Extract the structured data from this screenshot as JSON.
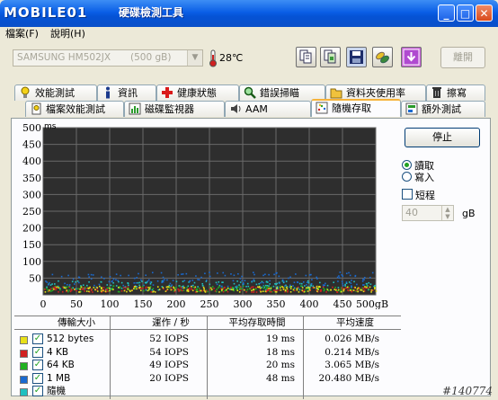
{
  "window": {
    "logo_text": "MOBILE01",
    "title": "硬碟檢測工具",
    "minimize": "_",
    "maximize": "□",
    "close": "✕"
  },
  "menu": [
    {
      "label": "檔案(F)"
    },
    {
      "label": "說明(H)"
    }
  ],
  "toolbar": {
    "drive_select": "SAMSUNG HM502JX",
    "drive_size": "(500 gB)",
    "temperature": "28℃",
    "disconnect_label": "離開"
  },
  "tabs_row1": [
    {
      "label": "效能測試",
      "icon": "bulb-icon"
    },
    {
      "label": "資訊",
      "icon": "info-icon"
    },
    {
      "label": "健康狀態",
      "icon": "health-cross-icon"
    },
    {
      "label": "錯誤掃瞄",
      "icon": "magnifier-icon"
    },
    {
      "label": "資料夾使用率",
      "icon": "folder-icon"
    },
    {
      "label": "擦寫",
      "icon": "trash-icon"
    }
  ],
  "tabs_row2": [
    {
      "label": "檔案效能測試",
      "icon": "file-benchmark-icon"
    },
    {
      "label": "磁碟監視器",
      "icon": "monitor-chart-icon"
    },
    {
      "label": "AAM",
      "icon": "speaker-icon"
    },
    {
      "label": "隨機存取",
      "icon": "random-access-icon",
      "active": true
    },
    {
      "label": "額外測試",
      "icon": "extra-test-icon"
    }
  ],
  "controls": {
    "stop_label": "停止",
    "read_label": "讀取",
    "write_label": "寫入",
    "short_label": "短程",
    "short_value": "40",
    "short_unit": "gB"
  },
  "chart_data": {
    "type": "scatter",
    "y_unit": "ms",
    "x_unit": "gB",
    "xlim": [
      0,
      500
    ],
    "ylim": [
      0,
      500
    ],
    "x_ticks": [
      "0",
      "50",
      "100",
      "150",
      "200",
      "250",
      "300",
      "350",
      "400",
      "450",
      "500gB"
    ],
    "y_ticks": [
      "500",
      "450",
      "400",
      "350",
      "300",
      "250",
      "200",
      "150",
      "100",
      "50"
    ],
    "grid": true,
    "series": [
      {
        "name": "512 bytes",
        "color": "#e8e018",
        "y_center": 19
      },
      {
        "name": "4 KB",
        "color": "#d02020",
        "y_center": 18
      },
      {
        "name": "64 KB",
        "color": "#20b020",
        "y_center": 20
      },
      {
        "name": "1 MB",
        "color": "#1a6ad0",
        "y_center": 48
      },
      {
        "name": "隨機",
        "color": "#20c0c0",
        "y_center": 30
      }
    ]
  },
  "table": {
    "headers": [
      "傳輸大小",
      "運作 / 秒",
      "平均存取時間",
      "平均速度"
    ],
    "rows": [
      {
        "size": "512 bytes",
        "iops": "52 IOPS",
        "access": "19 ms",
        "speed": "0.026 MB/s",
        "color": "#e8e018"
      },
      {
        "size": "4 KB",
        "iops": "54 IOPS",
        "access": "18 ms",
        "speed": "0.214 MB/s",
        "color": "#d02020"
      },
      {
        "size": "64 KB",
        "iops": "49 IOPS",
        "access": "20 ms",
        "speed": "3.065 MB/s",
        "color": "#20b020"
      },
      {
        "size": "1 MB",
        "iops": "20 IOPS",
        "access": "48 ms",
        "speed": "20.480 MB/s",
        "color": "#1a6ad0"
      },
      {
        "size": "隨機",
        "iops": "",
        "access": "",
        "speed": "",
        "color": "#20c0c0"
      }
    ]
  },
  "watermark": "#140774"
}
